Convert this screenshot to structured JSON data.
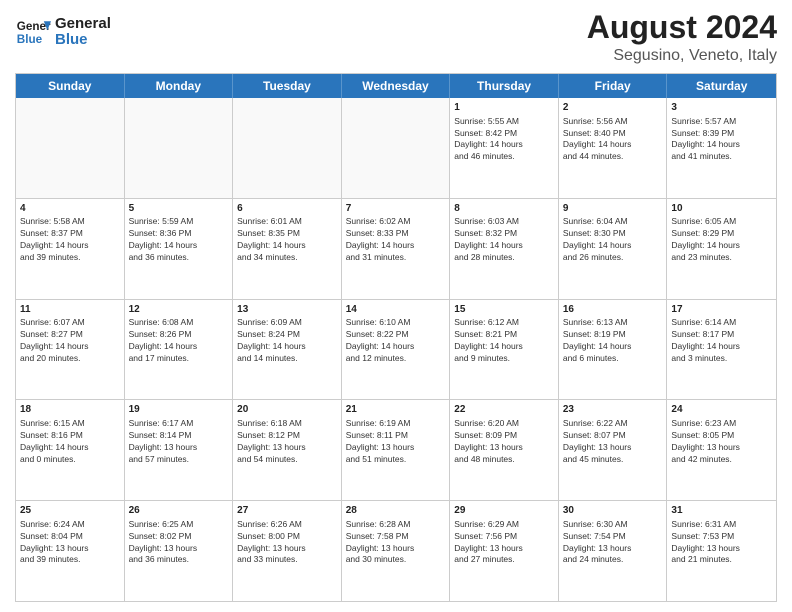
{
  "header": {
    "logo_line1": "General",
    "logo_line2": "Blue",
    "main_title": "August 2024",
    "subtitle": "Segusino, Veneto, Italy"
  },
  "calendar": {
    "days_of_week": [
      "Sunday",
      "Monday",
      "Tuesday",
      "Wednesday",
      "Thursday",
      "Friday",
      "Saturday"
    ],
    "weeks": [
      [
        {
          "day": "",
          "info": "",
          "empty": true
        },
        {
          "day": "",
          "info": "",
          "empty": true
        },
        {
          "day": "",
          "info": "",
          "empty": true
        },
        {
          "day": "",
          "info": "",
          "empty": true
        },
        {
          "day": "1",
          "info": "Sunrise: 5:55 AM\nSunset: 8:42 PM\nDaylight: 14 hours\nand 46 minutes.",
          "empty": false
        },
        {
          "day": "2",
          "info": "Sunrise: 5:56 AM\nSunset: 8:40 PM\nDaylight: 14 hours\nand 44 minutes.",
          "empty": false
        },
        {
          "day": "3",
          "info": "Sunrise: 5:57 AM\nSunset: 8:39 PM\nDaylight: 14 hours\nand 41 minutes.",
          "empty": false
        }
      ],
      [
        {
          "day": "4",
          "info": "Sunrise: 5:58 AM\nSunset: 8:37 PM\nDaylight: 14 hours\nand 39 minutes.",
          "empty": false
        },
        {
          "day": "5",
          "info": "Sunrise: 5:59 AM\nSunset: 8:36 PM\nDaylight: 14 hours\nand 36 minutes.",
          "empty": false
        },
        {
          "day": "6",
          "info": "Sunrise: 6:01 AM\nSunset: 8:35 PM\nDaylight: 14 hours\nand 34 minutes.",
          "empty": false
        },
        {
          "day": "7",
          "info": "Sunrise: 6:02 AM\nSunset: 8:33 PM\nDaylight: 14 hours\nand 31 minutes.",
          "empty": false
        },
        {
          "day": "8",
          "info": "Sunrise: 6:03 AM\nSunset: 8:32 PM\nDaylight: 14 hours\nand 28 minutes.",
          "empty": false
        },
        {
          "day": "9",
          "info": "Sunrise: 6:04 AM\nSunset: 8:30 PM\nDaylight: 14 hours\nand 26 minutes.",
          "empty": false
        },
        {
          "day": "10",
          "info": "Sunrise: 6:05 AM\nSunset: 8:29 PM\nDaylight: 14 hours\nand 23 minutes.",
          "empty": false
        }
      ],
      [
        {
          "day": "11",
          "info": "Sunrise: 6:07 AM\nSunset: 8:27 PM\nDaylight: 14 hours\nand 20 minutes.",
          "empty": false
        },
        {
          "day": "12",
          "info": "Sunrise: 6:08 AM\nSunset: 8:26 PM\nDaylight: 14 hours\nand 17 minutes.",
          "empty": false
        },
        {
          "day": "13",
          "info": "Sunrise: 6:09 AM\nSunset: 8:24 PM\nDaylight: 14 hours\nand 14 minutes.",
          "empty": false
        },
        {
          "day": "14",
          "info": "Sunrise: 6:10 AM\nSunset: 8:22 PM\nDaylight: 14 hours\nand 12 minutes.",
          "empty": false
        },
        {
          "day": "15",
          "info": "Sunrise: 6:12 AM\nSunset: 8:21 PM\nDaylight: 14 hours\nand 9 minutes.",
          "empty": false
        },
        {
          "day": "16",
          "info": "Sunrise: 6:13 AM\nSunset: 8:19 PM\nDaylight: 14 hours\nand 6 minutes.",
          "empty": false
        },
        {
          "day": "17",
          "info": "Sunrise: 6:14 AM\nSunset: 8:17 PM\nDaylight: 14 hours\nand 3 minutes.",
          "empty": false
        }
      ],
      [
        {
          "day": "18",
          "info": "Sunrise: 6:15 AM\nSunset: 8:16 PM\nDaylight: 14 hours\nand 0 minutes.",
          "empty": false
        },
        {
          "day": "19",
          "info": "Sunrise: 6:17 AM\nSunset: 8:14 PM\nDaylight: 13 hours\nand 57 minutes.",
          "empty": false
        },
        {
          "day": "20",
          "info": "Sunrise: 6:18 AM\nSunset: 8:12 PM\nDaylight: 13 hours\nand 54 minutes.",
          "empty": false
        },
        {
          "day": "21",
          "info": "Sunrise: 6:19 AM\nSunset: 8:11 PM\nDaylight: 13 hours\nand 51 minutes.",
          "empty": false
        },
        {
          "day": "22",
          "info": "Sunrise: 6:20 AM\nSunset: 8:09 PM\nDaylight: 13 hours\nand 48 minutes.",
          "empty": false
        },
        {
          "day": "23",
          "info": "Sunrise: 6:22 AM\nSunset: 8:07 PM\nDaylight: 13 hours\nand 45 minutes.",
          "empty": false
        },
        {
          "day": "24",
          "info": "Sunrise: 6:23 AM\nSunset: 8:05 PM\nDaylight: 13 hours\nand 42 minutes.",
          "empty": false
        }
      ],
      [
        {
          "day": "25",
          "info": "Sunrise: 6:24 AM\nSunset: 8:04 PM\nDaylight: 13 hours\nand 39 minutes.",
          "empty": false
        },
        {
          "day": "26",
          "info": "Sunrise: 6:25 AM\nSunset: 8:02 PM\nDaylight: 13 hours\nand 36 minutes.",
          "empty": false
        },
        {
          "day": "27",
          "info": "Sunrise: 6:26 AM\nSunset: 8:00 PM\nDaylight: 13 hours\nand 33 minutes.",
          "empty": false
        },
        {
          "day": "28",
          "info": "Sunrise: 6:28 AM\nSunset: 7:58 PM\nDaylight: 13 hours\nand 30 minutes.",
          "empty": false
        },
        {
          "day": "29",
          "info": "Sunrise: 6:29 AM\nSunset: 7:56 PM\nDaylight: 13 hours\nand 27 minutes.",
          "empty": false
        },
        {
          "day": "30",
          "info": "Sunrise: 6:30 AM\nSunset: 7:54 PM\nDaylight: 13 hours\nand 24 minutes.",
          "empty": false
        },
        {
          "day": "31",
          "info": "Sunrise: 6:31 AM\nSunset: 7:53 PM\nDaylight: 13 hours\nand 21 minutes.",
          "empty": false
        }
      ]
    ]
  }
}
